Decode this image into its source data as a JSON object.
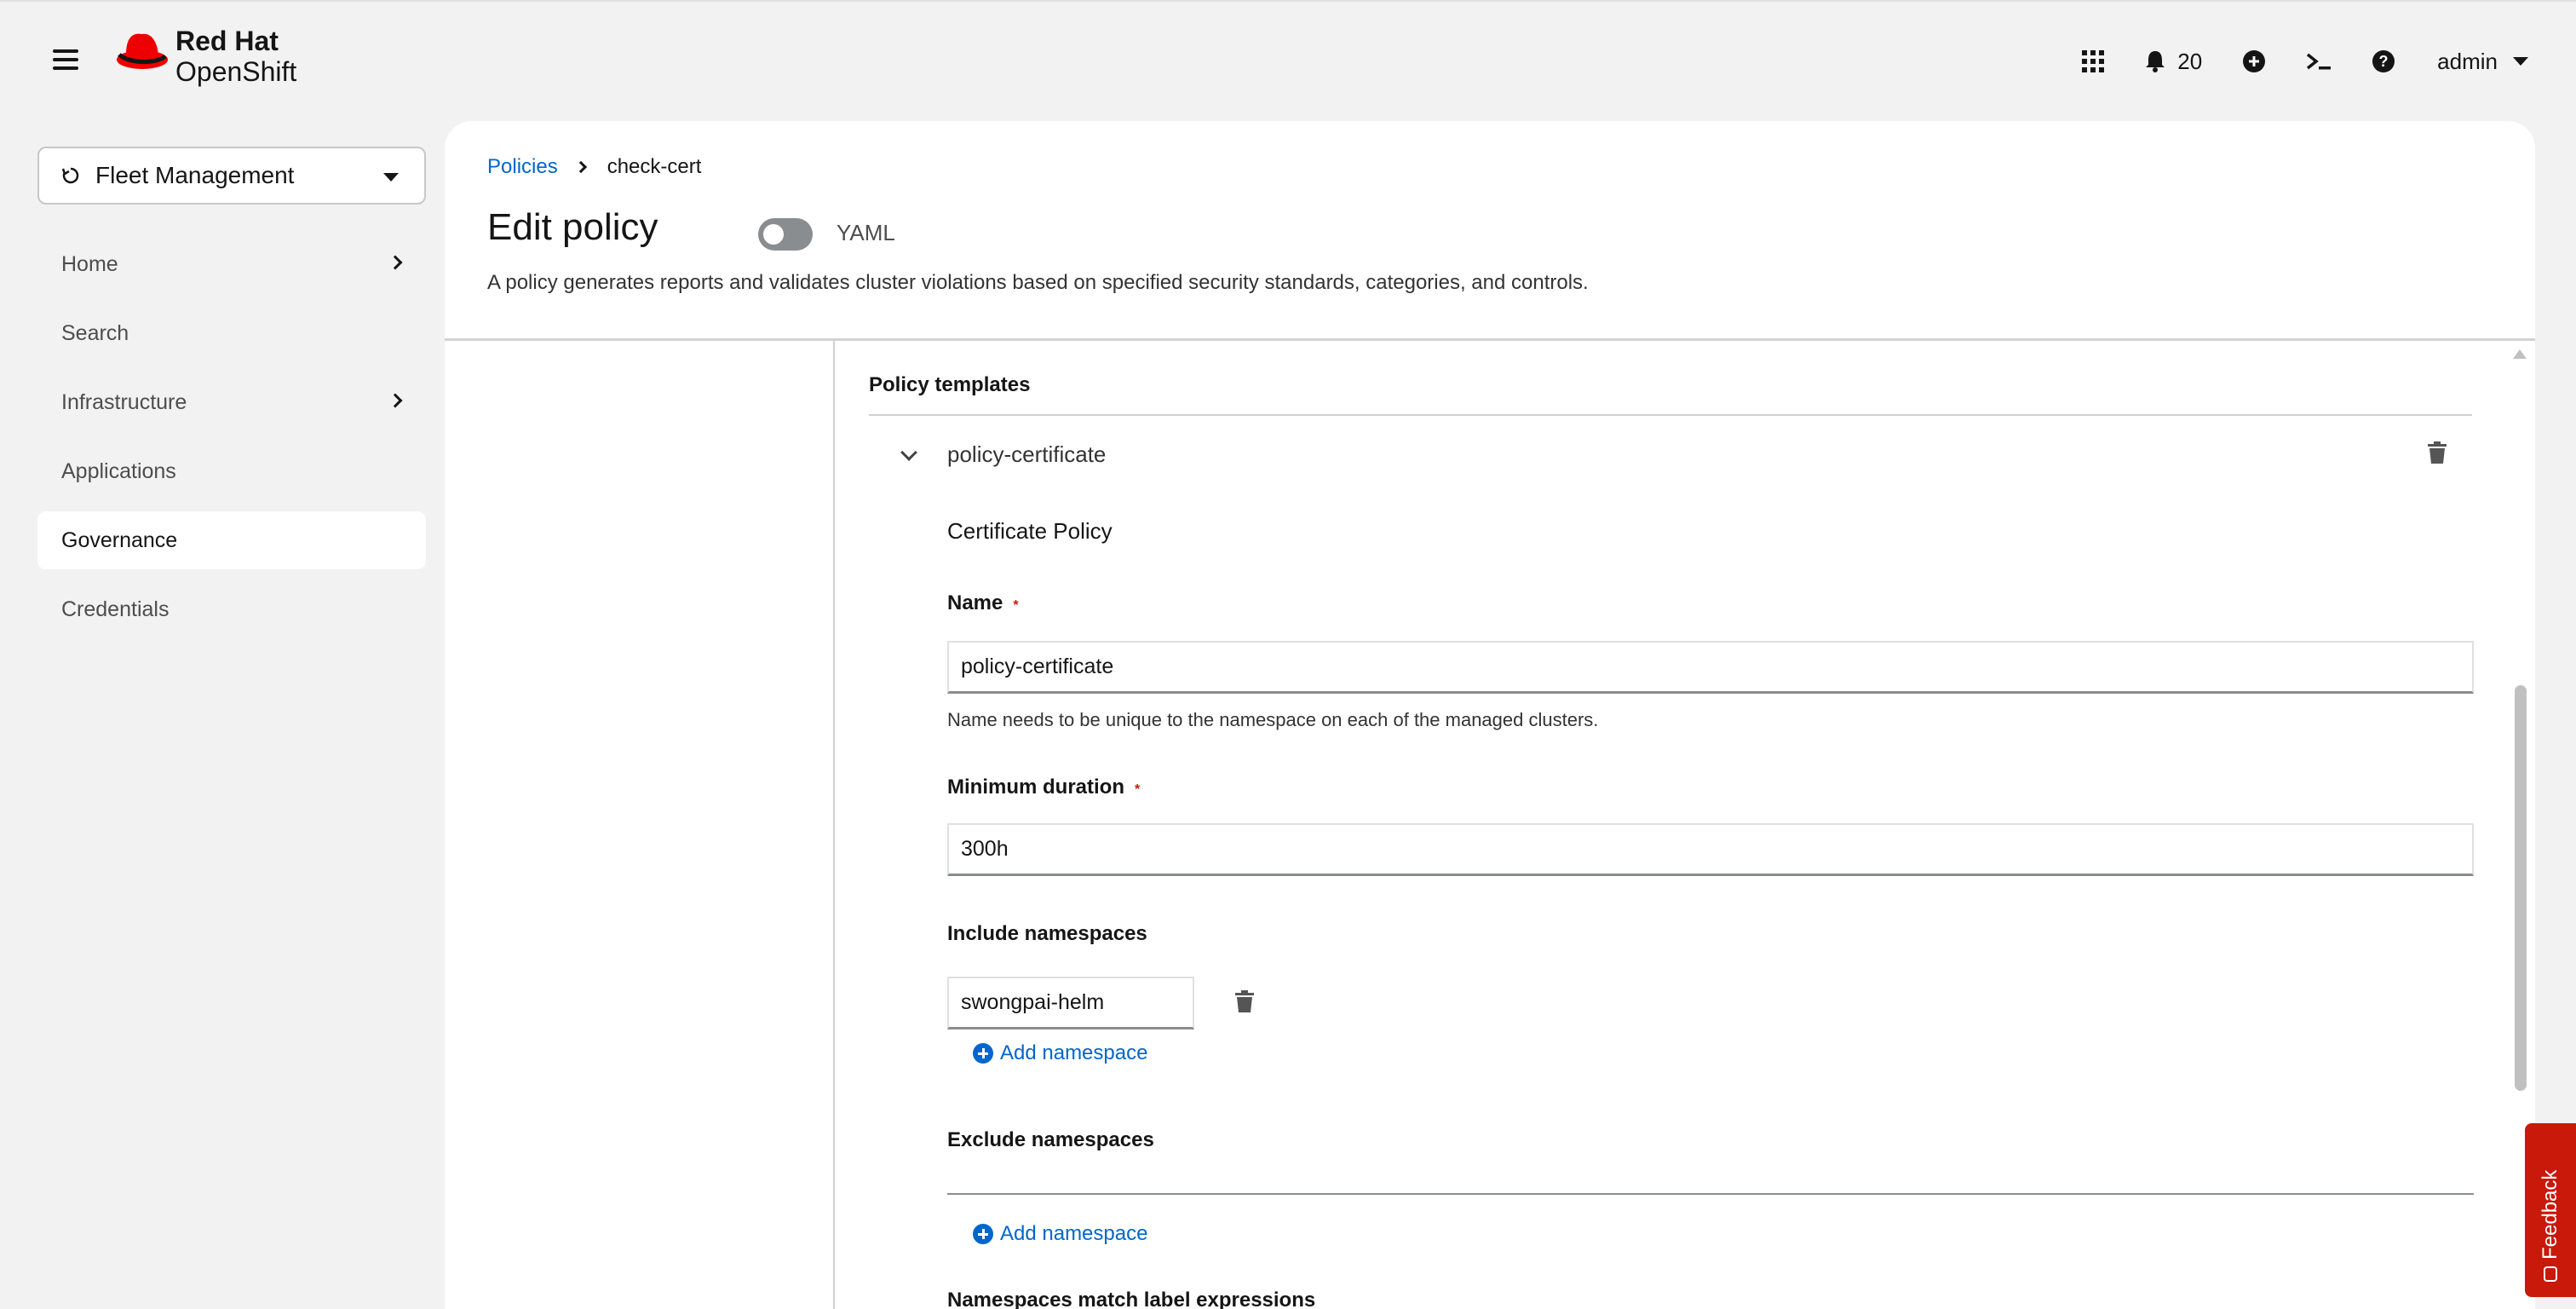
{
  "masthead": {
    "brand_line1": "Red Hat",
    "brand_line2": "OpenShift",
    "notification_count": "20",
    "user": "admin"
  },
  "sidebar": {
    "perspective": "Fleet Management",
    "items": [
      {
        "label": "Home",
        "expandable": true
      },
      {
        "label": "Search",
        "expandable": false
      },
      {
        "label": "Infrastructure",
        "expandable": true
      },
      {
        "label": "Applications",
        "expandable": false
      },
      {
        "label": "Governance",
        "expandable": false,
        "active": true
      },
      {
        "label": "Credentials",
        "expandable": false
      }
    ]
  },
  "header": {
    "breadcrumb": [
      "Policies",
      "check-cert"
    ],
    "title": "Edit policy",
    "yaml_toggle_label": "YAML",
    "yaml_enabled": false,
    "description": "A policy generates reports and validates cluster violations based on specified security standards, categories, and controls."
  },
  "form": {
    "section_title": "Policy templates",
    "template": {
      "name": "policy-certificate",
      "kind": "Certificate Policy",
      "name_label": "Name",
      "name_value": "policy-certificate",
      "name_helper": "Name needs to be unique to the namespace on each of the managed clusters.",
      "min_duration_label": "Minimum duration",
      "min_duration_value": "300h",
      "include_label": "Include namespaces",
      "include_values": [
        "swongpai-helm"
      ],
      "add_namespace_label": "Add namespace",
      "exclude_label": "Exclude namespaces",
      "match_label_expr": "Namespaces match label expressions"
    }
  },
  "feedback_label": "Feedback",
  "colors": {
    "link": "#0066cc",
    "required": "#c9190b",
    "brand_red": "#ee0000",
    "feedback": "#c9190b"
  }
}
